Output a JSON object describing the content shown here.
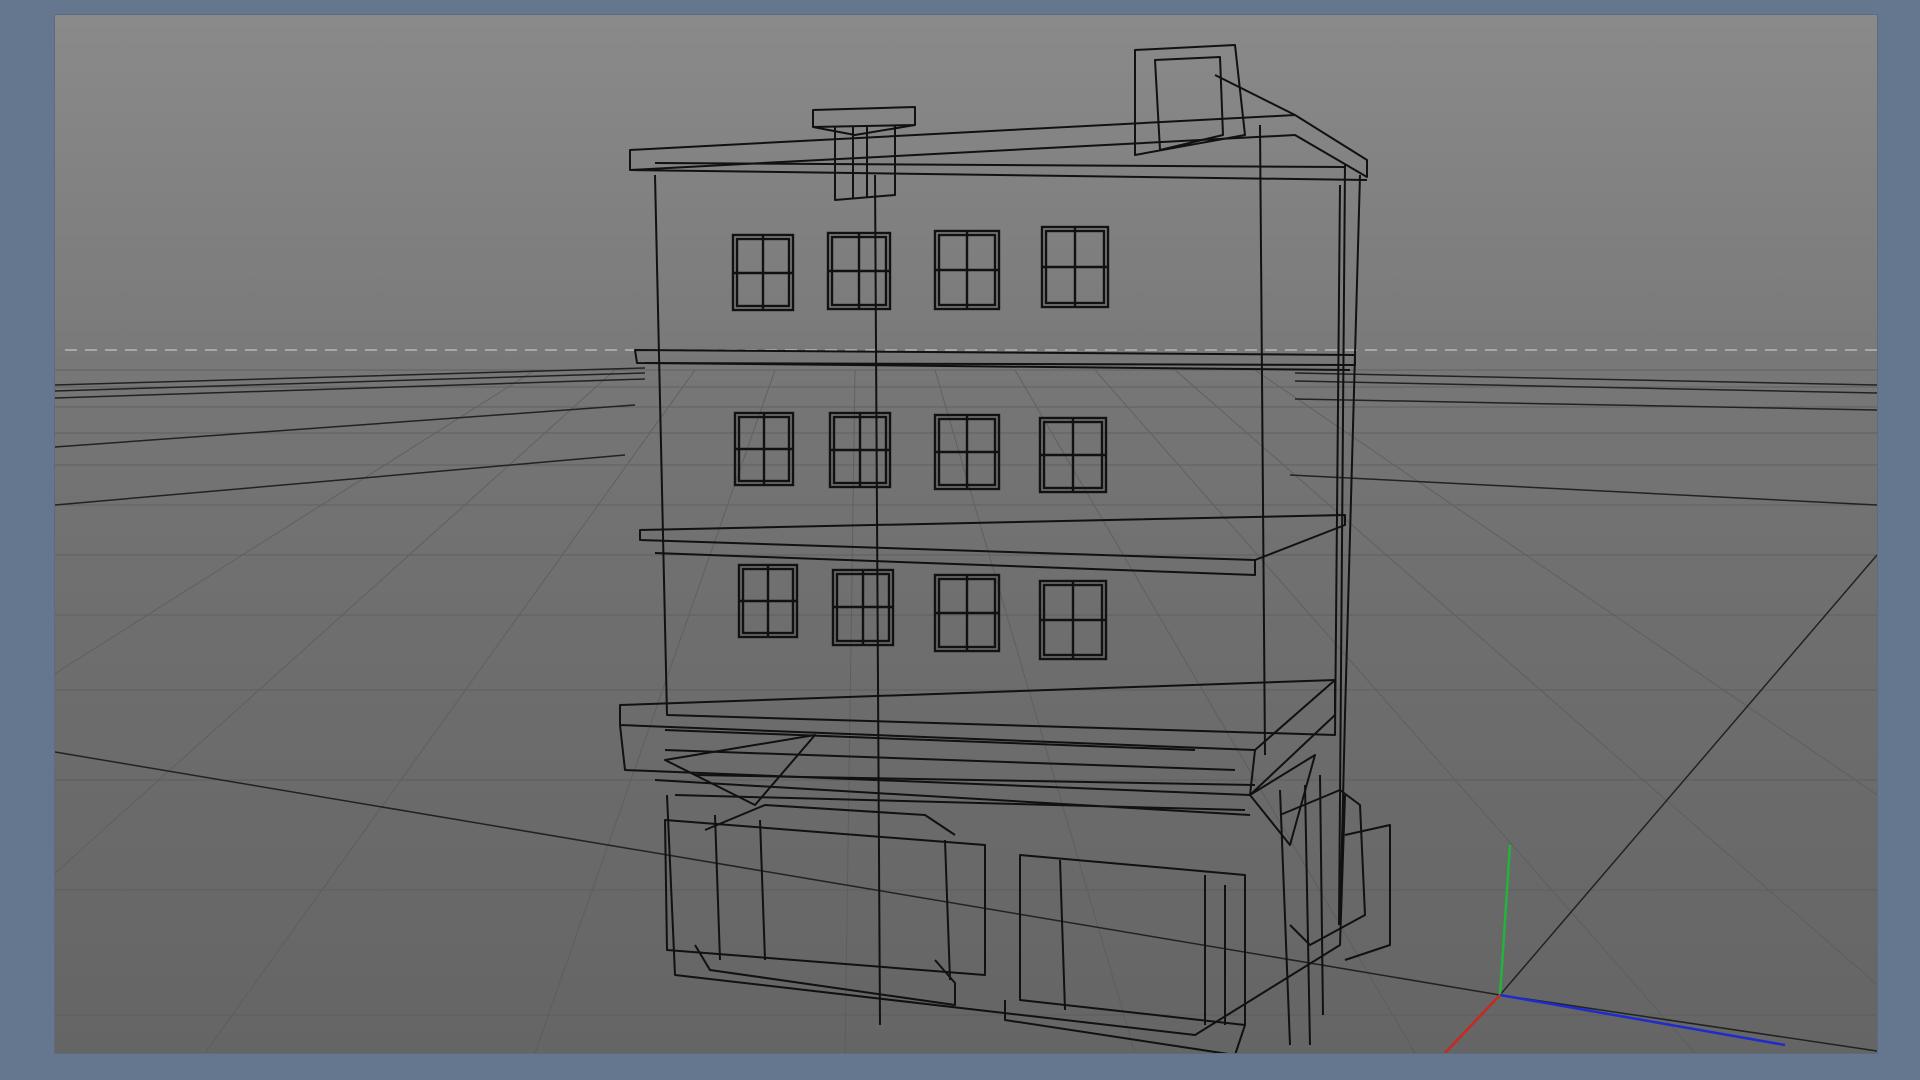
{
  "app": {
    "window": "3d-viewport",
    "shading_mode": "wireframe"
  },
  "viewport": {
    "background_top": "#8a8a8a",
    "background_bottom": "#656565",
    "frame_color": "#64778f",
    "wire_color": "#111111",
    "grid_color": "#555555",
    "horizon_guide_color": "#bdbdbd"
  },
  "axis_gizmo": {
    "x_color": "#1d2bd0",
    "y_color": "#22b43a",
    "z_color": "#c8281e"
  },
  "scene": {
    "object": "building-wireframe"
  }
}
